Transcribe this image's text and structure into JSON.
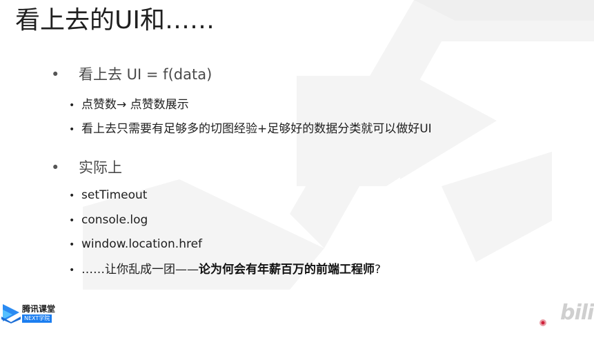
{
  "slide": {
    "title": "看上去的UI和……",
    "sections": [
      {
        "heading": "看上去 UI = f(data)",
        "items": [
          {
            "text": "点赞数→ 点赞数展示"
          },
          {
            "text": "看上去只需要有足够多的切图经验+足够好的数据分类就可以做好UI"
          }
        ]
      },
      {
        "heading": "实际上",
        "items": [
          {
            "text": "setTimeout"
          },
          {
            "text": "console.log"
          },
          {
            "text": "window.location.href"
          },
          {
            "text_prefix": "……让你乱成一团——",
            "text_bold": "论为何会有年薪百万的前端工程师",
            "text_suffix": "?"
          }
        ]
      }
    ],
    "bullet_level1": "•",
    "bullet_level2": "•"
  },
  "branding": {
    "logo_name": "腾讯课堂",
    "logo_sub": "NEXT学院",
    "logo_icon": "tencent-classroom-logo-icon",
    "corner_mark": "bili",
    "accent_color": "#1c7ef0"
  }
}
